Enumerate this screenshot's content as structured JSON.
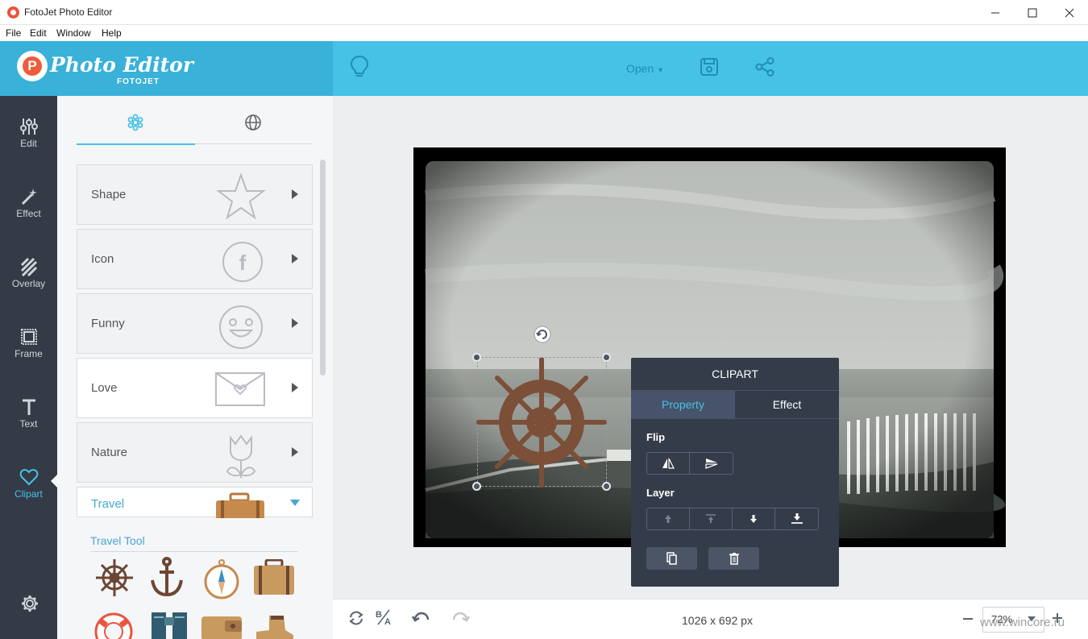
{
  "window": {
    "title": "FotoJet Photo Editor",
    "menu": [
      "File",
      "Edit",
      "Window",
      "Help"
    ]
  },
  "header": {
    "logo_text": "Photo Editor",
    "logo_sub": "FOTOJET",
    "open_label": "Open",
    "icons": [
      "lightbulb-icon",
      "save-icon",
      "share-icon"
    ]
  },
  "rail": {
    "items": [
      {
        "label": "Edit",
        "icon": "sliders-icon"
      },
      {
        "label": "Effect",
        "icon": "magic-wand-icon"
      },
      {
        "label": "Overlay",
        "icon": "hatch-icon"
      },
      {
        "label": "Frame",
        "icon": "frame-icon"
      },
      {
        "label": "Text",
        "icon": "text-icon"
      },
      {
        "label": "Clipart",
        "icon": "heart-icon",
        "active": true
      }
    ],
    "settings_icon": "gear-icon"
  },
  "panel": {
    "tabs": [
      {
        "icon": "snowflake-icon",
        "active": true
      },
      {
        "icon": "globe-icon",
        "active": false
      }
    ],
    "categories": [
      {
        "label": "Shape",
        "icon": "star-icon"
      },
      {
        "label": "Icon",
        "icon": "facebook-icon"
      },
      {
        "label": "Funny",
        "icon": "smiley-icon"
      },
      {
        "label": "Love",
        "icon": "envelope-heart-icon"
      },
      {
        "label": "Nature",
        "icon": "tulip-icon"
      }
    ],
    "expanded_category": {
      "label": "Travel",
      "icon": "suitcase-icon"
    },
    "subsection_title": "Travel Tool",
    "items": [
      "ship-wheel-icon",
      "anchor-icon",
      "compass-icon",
      "suitcase-icon",
      "life-buoy-icon",
      "binoculars-icon",
      "wallet-icon",
      "boot-icon"
    ]
  },
  "clipart_popup": {
    "title": "CLIPART",
    "tabs": [
      "Property",
      "Effect"
    ],
    "active_tab": "Property",
    "flip_label": "Flip",
    "layer_label": "Layer"
  },
  "bottom": {
    "dimensions": "1026 x 692 px",
    "zoom": "72%",
    "watermark": "www.wincore.ru"
  },
  "colors": {
    "accent": "#46c2e6",
    "rail": "#343b47",
    "popup": "#343c4a",
    "clipart_brown": "#7b4f38"
  }
}
